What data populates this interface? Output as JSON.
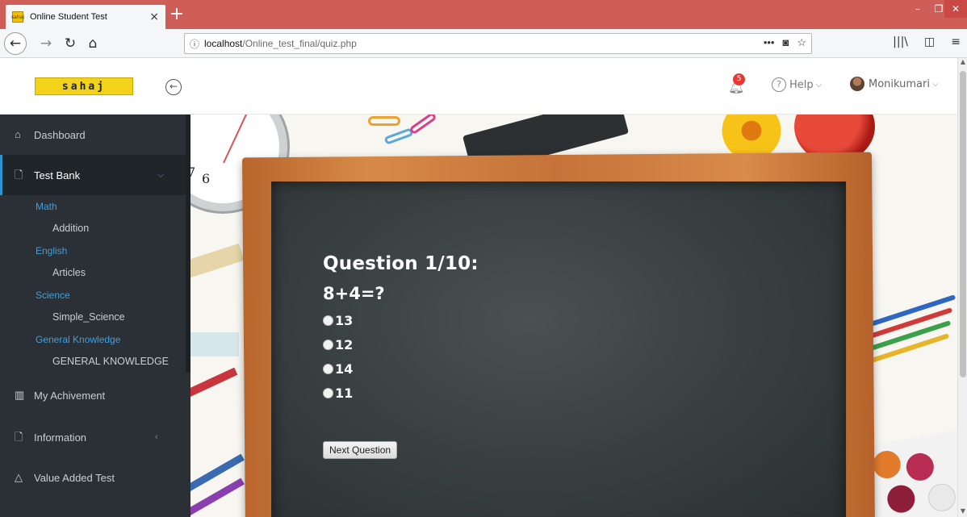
{
  "browser": {
    "tab_title": "Online Student Test",
    "tab_close": "×",
    "new_tab": "+",
    "favicon_text": "sahaj",
    "url_info_icon": "ⓘ",
    "url_host": "localhost",
    "url_path": "/Online_test_final/quiz.php",
    "url_more": "•••",
    "window_min": "–",
    "window_max": "❐",
    "window_close": "✕"
  },
  "header": {
    "logo_text": "sahaj",
    "notification_count": "5",
    "help_label": "Help",
    "user_name": "Monikumari"
  },
  "sidebar": {
    "items": [
      {
        "label": "Dashboard",
        "icon": "home-icon"
      },
      {
        "label": "Test Bank",
        "icon": "file-icon",
        "active": true
      },
      {
        "label": "My Achivement",
        "icon": "chart-icon"
      },
      {
        "label": "Information",
        "icon": "file-icon"
      },
      {
        "label": "Value Added Test",
        "icon": "bell-icon"
      }
    ],
    "categories": [
      {
        "label": "Math",
        "sub": "Addition"
      },
      {
        "label": "English",
        "sub": "Articles"
      },
      {
        "label": "Science",
        "sub": "Simple_Science"
      },
      {
        "label": "General Knowledge",
        "sub": "GENERAL KNOWLEDGE"
      }
    ]
  },
  "quiz": {
    "question_number": "Question 1/10:",
    "question_text": "8+4=?",
    "options": [
      "13",
      "12",
      "14",
      "11"
    ],
    "next_label": "Next Question"
  },
  "colors": {
    "titlebar": "#cf5e58",
    "sidebar_bg": "#2a3036",
    "accent": "#3fa0e0",
    "board": "#3a4142",
    "frame": "#c5733a",
    "badge": "#e53935"
  }
}
